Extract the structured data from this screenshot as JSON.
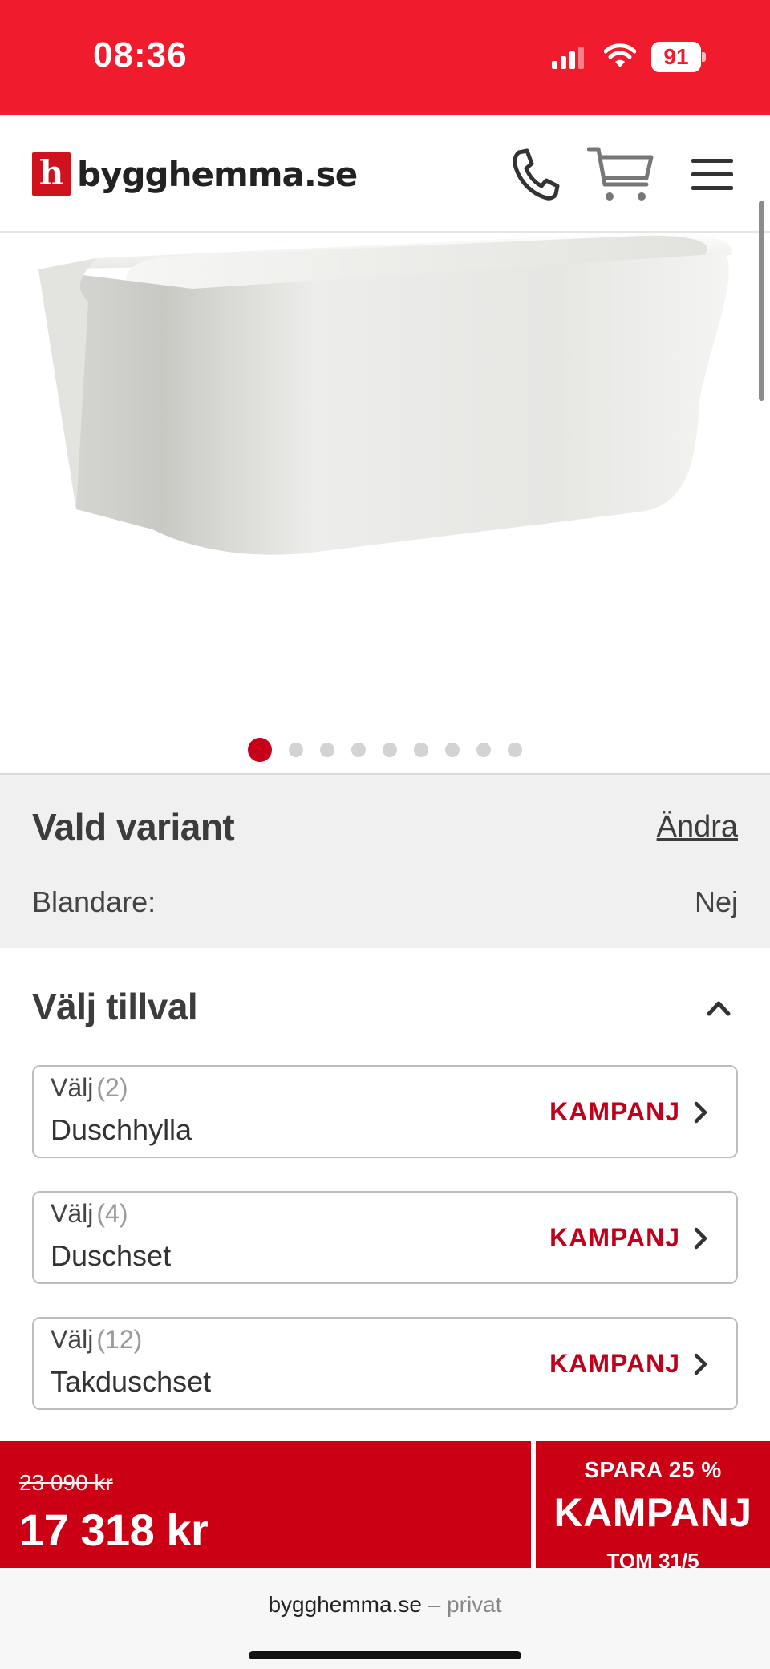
{
  "status_bar": {
    "time": "08:36",
    "battery": "91"
  },
  "header": {
    "logo_mark": "h",
    "logo_text": "bygghemma.se"
  },
  "gallery": {
    "image_count": 9,
    "active_index": 0
  },
  "variant": {
    "title": "Vald variant",
    "change_label": "Ändra",
    "attribute_label": "Blandare:",
    "attribute_value": "Nej"
  },
  "options": {
    "title": "Välj tillval",
    "items": [
      {
        "choose": "Välj",
        "count": "(2)",
        "name": "Duschhylla",
        "badge": "KAMPANJ"
      },
      {
        "choose": "Välj",
        "count": "(4)",
        "name": "Duschset",
        "badge": "KAMPANJ"
      },
      {
        "choose": "Välj",
        "count": "(12)",
        "name": "Takduschset",
        "badge": "KAMPANJ"
      }
    ]
  },
  "price": {
    "old": "23 090 kr",
    "current": "17 318 kr"
  },
  "promo": {
    "save": "SPARA 25 %",
    "label": "KAMPANJ",
    "date": "TOM 31/5"
  },
  "browser": {
    "domain": "bygghemma.se",
    "separator": "–",
    "mode": "privat"
  },
  "colors": {
    "brand_red": "#cc0015",
    "status_red": "#f01b2c",
    "accent_text_red": "#c0001a"
  }
}
